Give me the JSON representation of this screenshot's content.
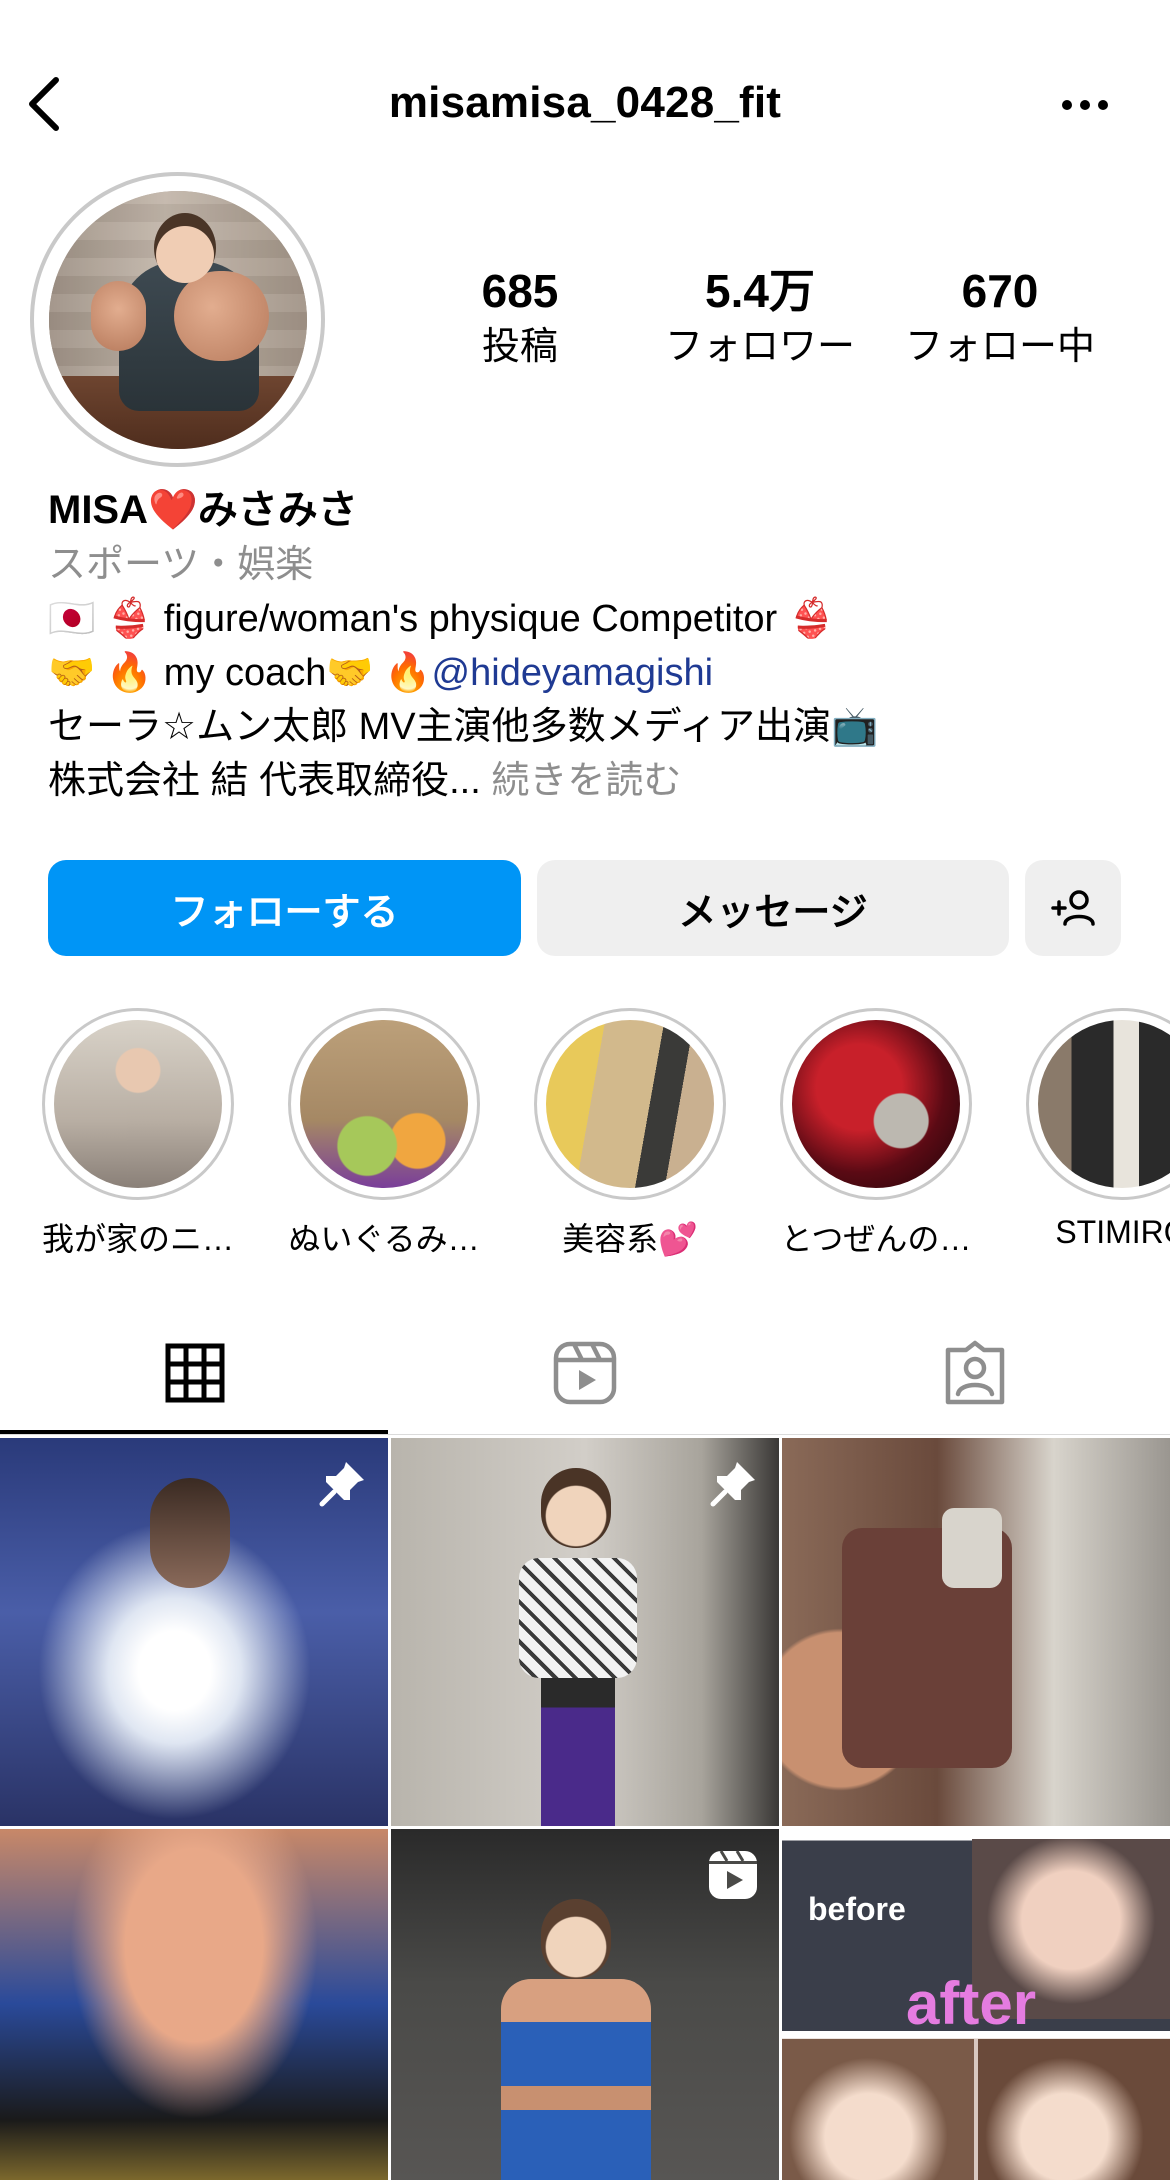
{
  "header": {
    "username": "misamisa_0428_fit"
  },
  "stats": [
    {
      "value": "685",
      "label": "投稿"
    },
    {
      "value": "5.4万",
      "label": "フォロワー"
    },
    {
      "value": "670",
      "label": "フォロー中"
    }
  ],
  "bio": {
    "name": "MISA❤️みさみさ",
    "category": "スポーツ・娯楽",
    "line1": "🇯🇵 👙 figure/woman's physique Competitor 👙",
    "line2_prefix": "🤝 🔥 my coach🤝 🔥",
    "line2_mention": "@hideyamagishi",
    "line3": "セーラ☆ムン太郎 MV主演他多数メディア出演📺",
    "line4": "株式会社 結 代表取締役...",
    "more": "続きを読む"
  },
  "buttons": {
    "follow": "フォローする",
    "message": "メッセージ"
  },
  "highlights": [
    {
      "label": "我が家のニ…"
    },
    {
      "label": "ぬいぐるみ…"
    },
    {
      "label": "美容系💕"
    },
    {
      "label": "とつぜんの…"
    },
    {
      "label": "STIMIRO"
    }
  ],
  "grid": {
    "before_label": "before",
    "after_label": "after"
  },
  "icons": {
    "back": "chevron-left-icon",
    "more": "more-horizontal-icon",
    "add_user": "add-user-icon",
    "grid_tab": "grid-icon",
    "reels_tab": "reels-icon",
    "tagged_tab": "tagged-user-icon",
    "pin": "pin-icon",
    "reel_badge": "reel-icon"
  },
  "colors": {
    "accent": "#0095f6",
    "mention": "#1f3a93",
    "muted": "#8e8e8e"
  }
}
